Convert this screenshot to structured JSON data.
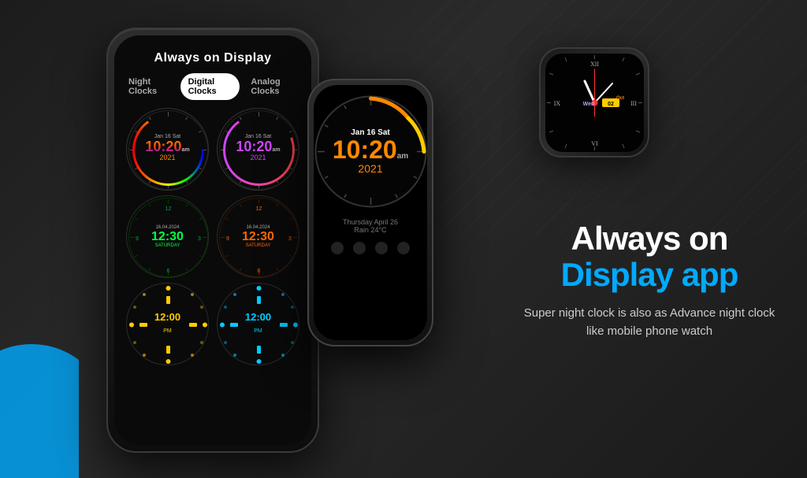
{
  "app": {
    "title": "Always on Display",
    "tabs": [
      {
        "id": "night",
        "label": "Night Clocks",
        "active": false
      },
      {
        "id": "digital",
        "label": "Digital Clocks",
        "active": true
      },
      {
        "id": "analog",
        "label": "Analog Clocks",
        "active": false
      }
    ]
  },
  "clocks": [
    {
      "id": "rainbow-analog",
      "date": "Jan 16 Sat",
      "time": "10:20",
      "ampm": "am",
      "year": "2021",
      "color": "rainbow"
    },
    {
      "id": "purple-analog",
      "date": "Jan 16 Sat",
      "time": "10:20",
      "ampm": "am",
      "year": "2021",
      "color": "purple"
    },
    {
      "id": "green-digital",
      "date": "16.04.2024",
      "time": "12:30",
      "day": "SATURDAY",
      "color": "green"
    },
    {
      "id": "orange-digital",
      "date": "16.04.2024",
      "time": "12:30",
      "day": "SATURDAY",
      "color": "orange"
    },
    {
      "id": "yellow-dots",
      "time": "12:00",
      "ampm": "PM",
      "color": "yellow"
    },
    {
      "id": "cyan-dots",
      "time": "12:00",
      "ampm": "PM",
      "color": "cyan"
    }
  ],
  "big_clock": {
    "date": "Jan 16 Sat",
    "time": "10:20",
    "ampm": "am",
    "year": "2021"
  },
  "phone_info": {
    "weather_text": "Thursday April 26",
    "weather_condition": "Rain 24°C"
  },
  "watch": {
    "day": "Wed",
    "month": "Oct",
    "date": "02"
  },
  "headline": {
    "line1": "Always on",
    "line2": "Display app"
  },
  "subtext": "Super night clock is also as Advance night clock like mobile phone watch"
}
